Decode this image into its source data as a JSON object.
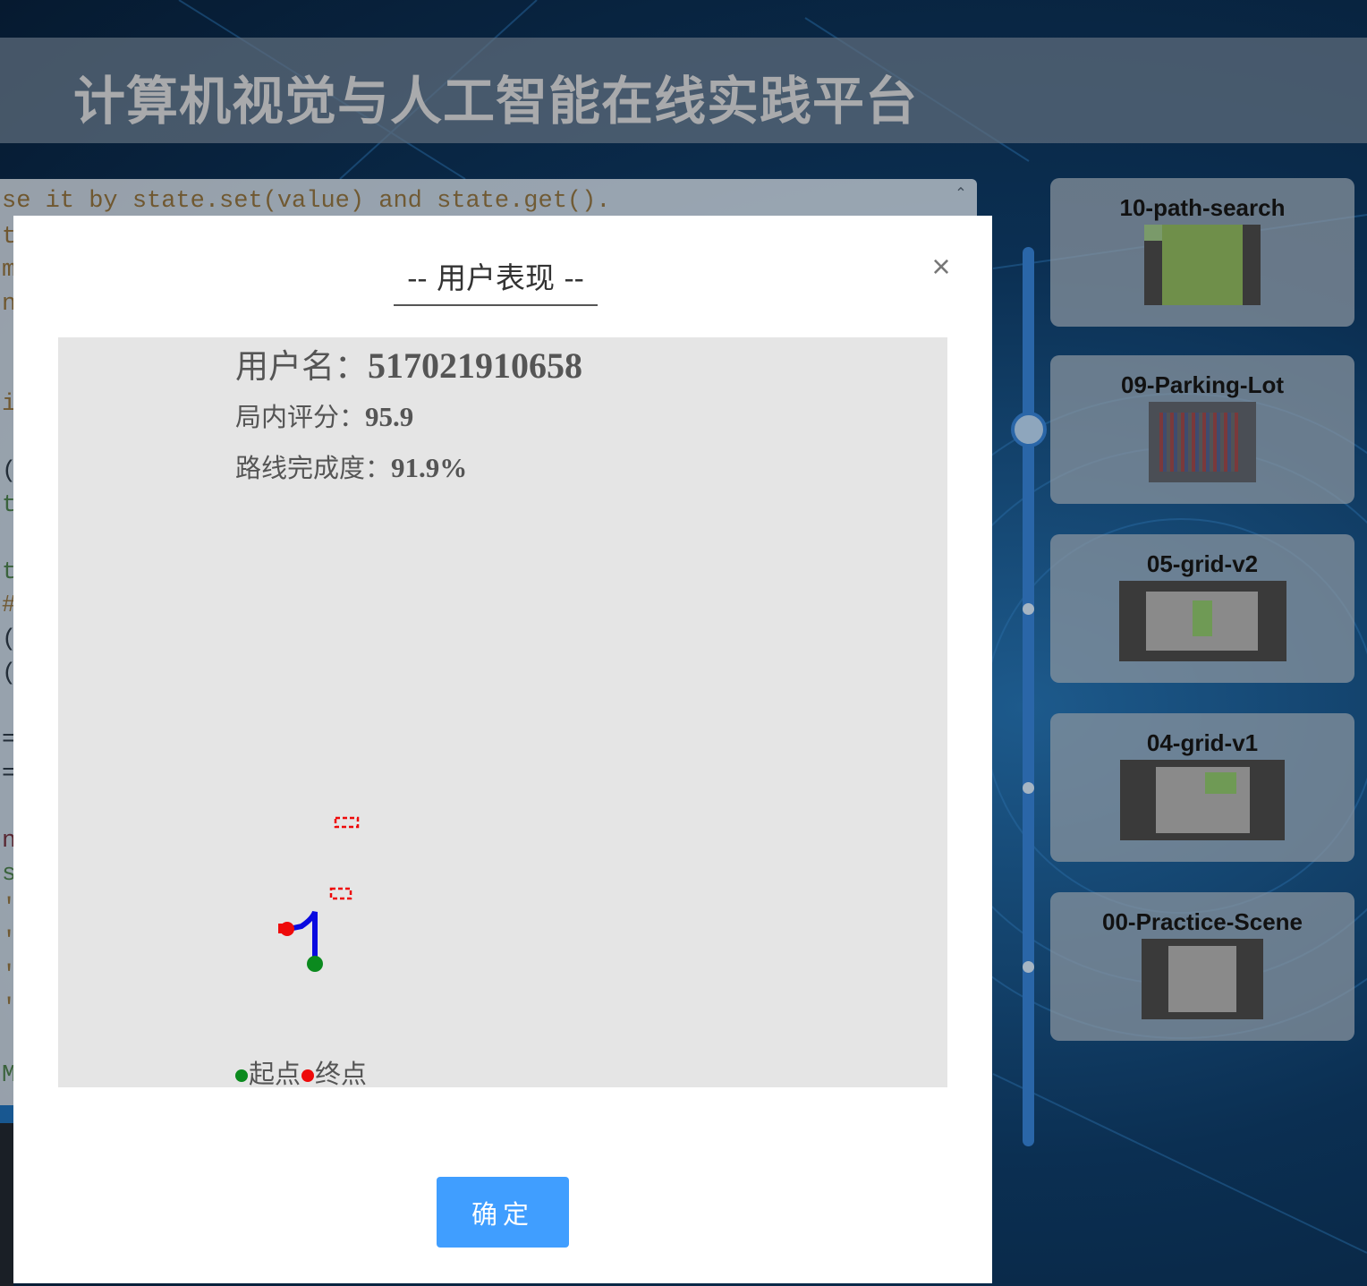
{
  "app": {
    "title": "计算机视觉与人工智能在线实践平台"
  },
  "editor": {
    "lines": [
      {
        "text": "se it by state.set(value) and state.get().",
        "color": "#b07a2a"
      },
      {
        "text": "t",
        "color": "#b07a2a"
      },
      {
        "text": "m",
        "color": "#b07a2a"
      },
      {
        "text": "n",
        "color": "#b07a2a"
      },
      {
        "text": "i",
        "color": "#b07a2a"
      },
      {
        "text": "(",
        "color": "#333333"
      },
      {
        "text": "t",
        "color": "#5a8a3a"
      },
      {
        "text": "t",
        "color": "#5a8a3a"
      },
      {
        "text": "#",
        "color": "#b07a2a"
      },
      {
        "text": "(",
        "color": "#333333"
      },
      {
        "text": "(",
        "color": "#333333"
      },
      {
        "text": "=",
        "color": "#333333"
      },
      {
        "text": "=",
        "color": "#333333"
      },
      {
        "text": "n",
        "color": "#8a2a2a"
      },
      {
        "text": "s",
        "color": "#5a8a3a"
      },
      {
        "text": "'",
        "color": "#b07a2a"
      },
      {
        "text": "'",
        "color": "#b07a2a"
      },
      {
        "text": "'",
        "color": "#b07a2a"
      },
      {
        "text": "'",
        "color": "#b07a2a"
      },
      {
        "text": "M",
        "color": "#5a8a3a"
      }
    ]
  },
  "scenes": [
    {
      "name": "10-path-search",
      "thumb_color": "#2e2e2e",
      "accent": "#6f8f4a"
    },
    {
      "name": "09-Parking-Lot",
      "thumb_color": "#4a4e55",
      "accent": "#8f3030"
    },
    {
      "name": "05-grid-v2",
      "thumb_color": "#2f2f2f",
      "accent": "#6f9a55"
    },
    {
      "name": "04-grid-v1",
      "thumb_color": "#2f2f2f",
      "accent": "#6f9a55"
    },
    {
      "name": "00-Practice-Scene",
      "thumb_color": "#2a2a2a",
      "accent": "#8a8a8a"
    }
  ],
  "modal": {
    "title": "-- 用户表现 --",
    "username_label": "用户名：",
    "username": "517021910658",
    "score_label": "局内评分：",
    "score": "95.9",
    "completion_label": "路线完成度：",
    "completion": "91.9%",
    "legend_start": "起点",
    "legend_end": "终点",
    "confirm_label": "确定",
    "colors": {
      "start": "#0b8a1e",
      "end": "#ee0a0a",
      "path": "#0a0ae0",
      "confirm": "#409eff"
    }
  }
}
